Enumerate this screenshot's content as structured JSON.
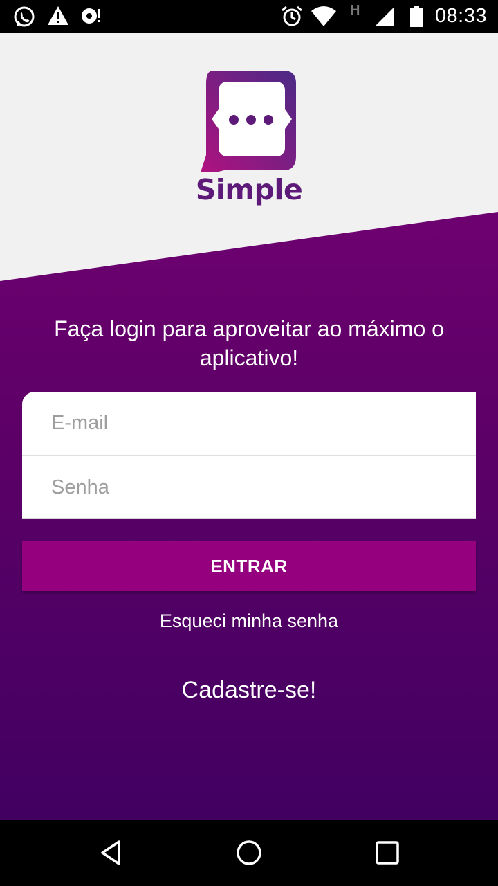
{
  "status_bar": {
    "time": "08:33",
    "network_letter": "H",
    "icons": [
      "whatsapp-icon",
      "warning-icon",
      "media-icon",
      "alarm-icon",
      "wifi-icon",
      "signal-icon",
      "battery-icon"
    ]
  },
  "brand": {
    "name": "Simple",
    "logo_icon": "chat-bubble-logo-icon",
    "colors": {
      "logo_start": "#b2117f",
      "logo_end": "#4b2a86",
      "text": "#5d1a78"
    }
  },
  "login": {
    "headline": "Faça login para aproveitar ao máximo o aplicativo!",
    "email_placeholder": "E-mail",
    "password_placeholder": "Senha",
    "enter_label": "ENTRAR",
    "forgot_label": "Esqueci minha senha",
    "signup_label": "Cadastre-se!"
  },
  "colors": {
    "background_top": "#f1f1f1",
    "gradient_top": "#7b0277",
    "gradient_bottom": "#420061",
    "button": "#95007e"
  },
  "nav": {
    "icons": [
      "back-icon",
      "home-icon",
      "recents-icon"
    ]
  }
}
